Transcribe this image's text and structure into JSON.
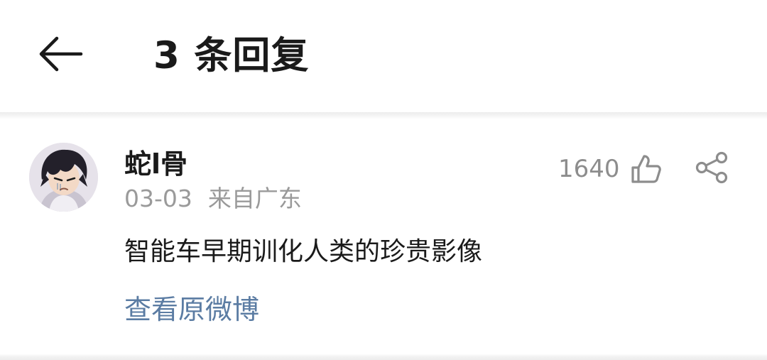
{
  "header": {
    "back_icon": "arrow-left-icon",
    "title": "3 条回复"
  },
  "comment": {
    "username": "蛇l骨",
    "date": "03-03",
    "location": "来自广东",
    "like_count": "1640",
    "like_icon": "thumbs-up-icon",
    "share_icon": "share-icon",
    "text": "智能车早期训化人类的珍贵影像",
    "view_original": "查看原微博"
  },
  "colors": {
    "text_primary": "#1a1a1a",
    "text_secondary": "#9a9a9a",
    "link": "#5b7ca3",
    "icon": "#8d8d8d"
  }
}
